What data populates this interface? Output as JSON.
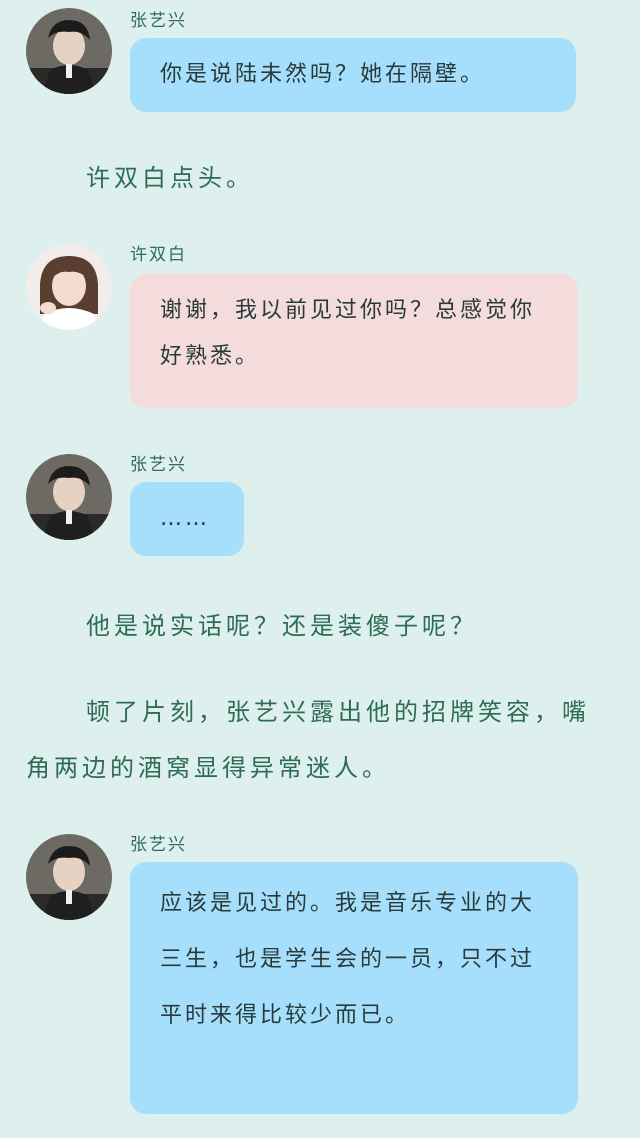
{
  "messages": [
    {
      "sender": "张艺兴",
      "text": "你是说陆未然吗？她在隔壁。"
    },
    {
      "sender": "许双白",
      "text": "谢谢，我以前见过你吗？总感觉你好熟悉。"
    },
    {
      "sender": "张艺兴",
      "text": "……"
    },
    {
      "sender": "张艺兴",
      "text": "应该是见过的。我是音乐专业的大三生，也是学生会的一员，只不过平时来得比较少而已。"
    }
  ],
  "narration": [
    "许双白点头。",
    "他是说实话呢？还是装傻子呢？",
    "顿了片刻，张艺兴露出他的招牌笑容，嘴角两边的酒窝显得异常迷人。"
  ],
  "colors": {
    "background": "#ddf0ee",
    "bubble_blue": "#a6dffb",
    "bubble_pink": "#f4dcdc",
    "narration_text": "#2e6c55"
  }
}
